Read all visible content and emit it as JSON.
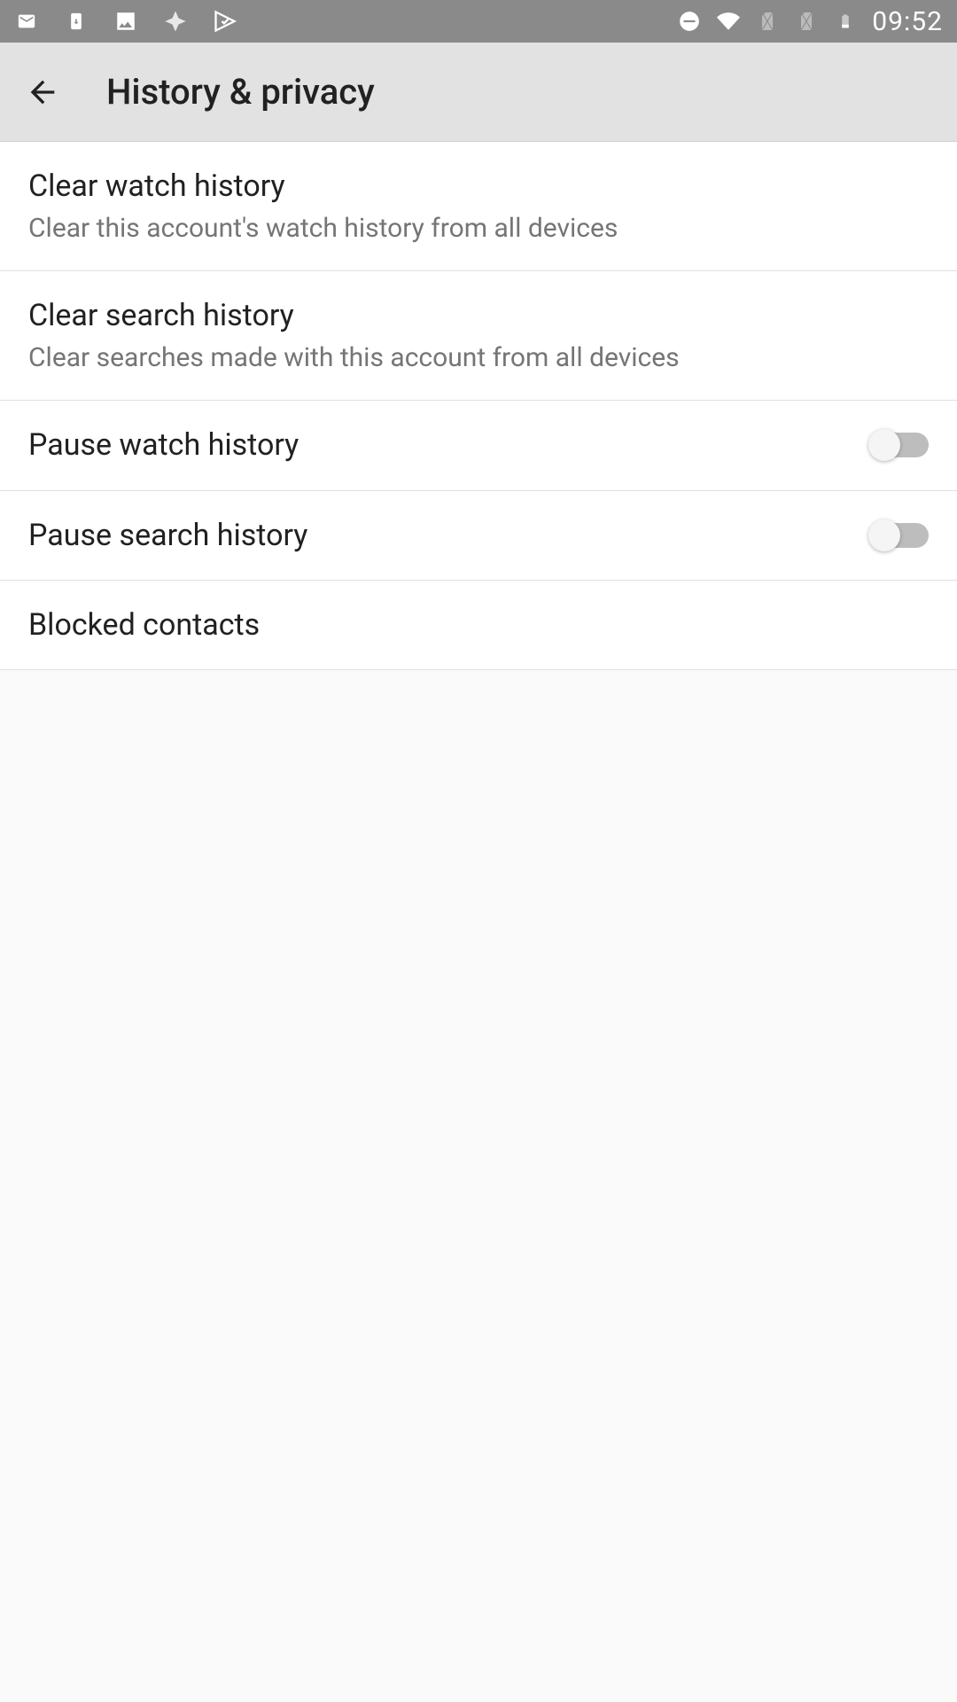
{
  "status": {
    "time": "09:52"
  },
  "header": {
    "title": "History & privacy"
  },
  "settings": {
    "clear_watch": {
      "title": "Clear watch history",
      "subtitle": "Clear this account's watch history from all devices"
    },
    "clear_search": {
      "title": "Clear search history",
      "subtitle": "Clear searches made with this account from all devices"
    },
    "pause_watch": {
      "title": "Pause watch history"
    },
    "pause_search": {
      "title": "Pause search history"
    },
    "blocked": {
      "title": "Blocked contacts"
    }
  }
}
